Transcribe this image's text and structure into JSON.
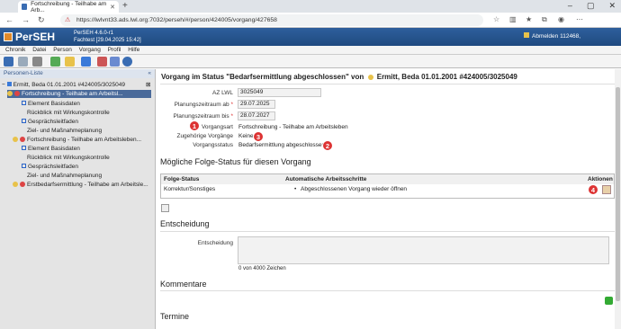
{
  "browser": {
    "tab_title": "Fortschreibung - Teilhabe am Arb...",
    "url": "https://lwlvnt33.ads.lwl.org:7032/perseh/#/person/424005/vorgang/427658",
    "url_warning": "⚠"
  },
  "app": {
    "name": "PerSEH",
    "version": "PerSEH 4.6.0-r1",
    "env": "Fachtest [29.04.2025 15:42]",
    "logout": "Abmelden 112468,"
  },
  "menu": [
    "Chronik",
    "Datei",
    "Person",
    "Vorgang",
    "Profil",
    "Hilfe"
  ],
  "left": {
    "header": "Personen-Liste",
    "person": "Ermitt, Beda 01.01.2001 #424005/3025049",
    "items": [
      {
        "label": "Fortschreibung - Teilhabe am Arbeitsl...",
        "type": "vorgang",
        "selected": true
      },
      {
        "label": "Element Basisdaten",
        "type": "sub"
      },
      {
        "label": "Rückblick mit Wirkungskontrolle",
        "type": "plain"
      },
      {
        "label": "Gesprächsleitfaden",
        "type": "sub"
      },
      {
        "label": "Ziel- und Maßnahmeplanung",
        "type": "plain"
      },
      {
        "label": "Fortschreibung - Teilhabe am Arbeitsleben...",
        "type": "vorgang"
      },
      {
        "label": "Element Basisdaten",
        "type": "sub"
      },
      {
        "label": "Rückblick mit Wirkungskontrolle",
        "type": "plain"
      },
      {
        "label": "Gesprächsleitfaden",
        "type": "sub"
      },
      {
        "label": "Ziel- und Maßnahmeplanung",
        "type": "plain"
      },
      {
        "label": "Erstbedarfsermittlung - Teilhabe am Arbeitsle...",
        "type": "vorgang"
      }
    ]
  },
  "main": {
    "title_pre": "Vorgang im Status \"Bedarfsermittlung abgeschlossen\" von",
    "title_person": "Ermitt, Beda 01.01.2001 #424005/3025049",
    "fields": {
      "az_label": "AZ LWL",
      "az_value": "3025049",
      "ab_label": "Planungszeitraum ab",
      "ab_value": "29.07.2025",
      "bis_label": "Planungszeitraum bis",
      "bis_value": "28.07.2027",
      "art_label": "Vorgangsart",
      "art_value": "Fortschreibung - Teilhabe am Arbeitsleben",
      "zug_label": "Zugehörige Vorgänge",
      "zug_value": "Keine",
      "status_label": "Vorgangsstatus",
      "status_value": "Bedarfsermittlung abgeschlossen"
    },
    "required_mark": "*",
    "folge_title": "Mögliche Folge-Status für diesen Vorgang",
    "table": {
      "headers": [
        "Folge-Status",
        "Automatische Arbeitsschritte",
        "Aktionen"
      ],
      "rows": [
        [
          "Korrektur/Sonstiges",
          "Abgeschlossenen Vorgang wieder öffnen"
        ]
      ]
    },
    "entscheidung_title": "Entscheidung",
    "entscheidung_label": "Entscheidung",
    "char_count": "0 von 4000 Zeichen",
    "kommentare_title": "Kommentare",
    "termine_title": "Termine",
    "badges": [
      "1",
      "2",
      "3",
      "4"
    ]
  },
  "colors": {
    "header_blue": "#1f4a80",
    "badge_red": "#d33",
    "selected": "#4a6a9a"
  }
}
